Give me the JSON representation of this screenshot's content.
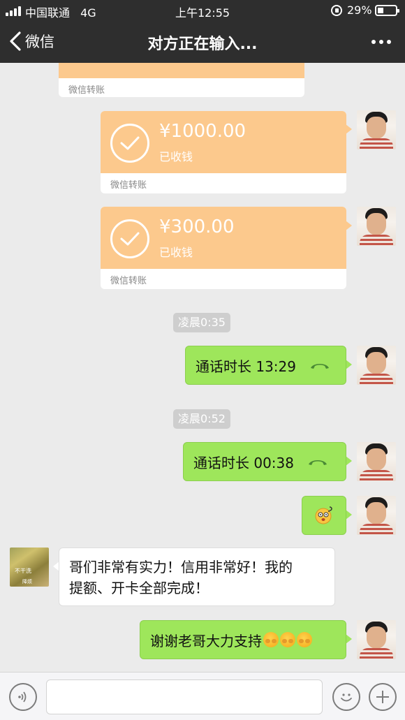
{
  "status_bar": {
    "carrier": "中国联通",
    "network": "4G",
    "time": "上午12:55",
    "battery": "29%"
  },
  "nav": {
    "back_label": "微信",
    "title": "对方正在输入..."
  },
  "messages": [
    {
      "type": "transfer",
      "from": "me",
      "footer": "微信转账",
      "partial": true
    },
    {
      "type": "transfer",
      "from": "me",
      "amount": "¥1000.00",
      "status": "已收钱",
      "footer": "微信转账"
    },
    {
      "type": "transfer",
      "from": "me",
      "amount": "¥300.00",
      "status": "已收钱",
      "footer": "微信转账"
    },
    {
      "type": "time",
      "text": "凌晨0:35"
    },
    {
      "type": "call",
      "from": "me",
      "text": "通话时长 13:29"
    },
    {
      "type": "time",
      "text": "凌晨0:52"
    },
    {
      "type": "call",
      "from": "me",
      "text": "通话时长 00:38"
    },
    {
      "type": "sticker",
      "from": "me",
      "icon": "dizzy-face-emoji"
    },
    {
      "type": "text",
      "from": "other",
      "lines": [
        "哥们非常有实力！信用非常好！我的",
        "提额、开卡全部完成！"
      ]
    },
    {
      "type": "text",
      "from": "me",
      "text": "谢谢老哥大力支持",
      "emoji_count": 3,
      "emoji_icon": "grimace-face-emoji"
    }
  ],
  "other_avatar_text": [
    "不干洗",
    "降烦"
  ],
  "colors": {
    "nav_bg": "#2e2e2e",
    "chat_bg": "#ebebeb",
    "transfer_orange": "#fcc98d",
    "bubble_green": "#9ee65b",
    "time_pill": "#cecece"
  }
}
